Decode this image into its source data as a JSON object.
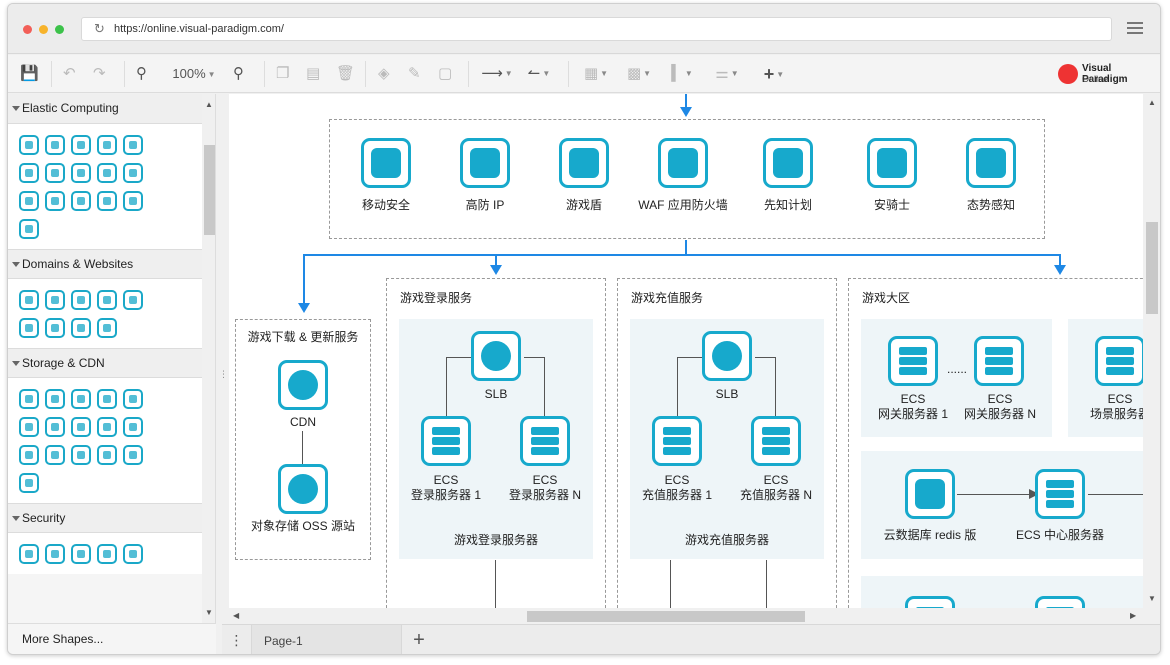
{
  "browser": {
    "url": "https://online.visual-paradigm.com/"
  },
  "toolbar": {
    "zoom": "100%",
    "logo_line1": "Visual Paradigm",
    "logo_line2": "Online"
  },
  "sidebar": {
    "categories": [
      {
        "name": "Elastic Computing"
      },
      {
        "name": "Domains & Websites"
      },
      {
        "name": "Storage & CDN"
      },
      {
        "name": "Security"
      }
    ],
    "more_shapes": "More Shapes..."
  },
  "pages": {
    "current": "Page-1"
  },
  "diagram": {
    "security": [
      "移动安全",
      "高防 IP",
      "游戏盾",
      "WAF 应用防火墙",
      "先知计划",
      "安骑士",
      "态势感知"
    ],
    "download": {
      "title": "游戏下载 & 更新服务",
      "cdn": "CDN",
      "oss": "对象存储 OSS 源站"
    },
    "login": {
      "title": "游戏登录服务",
      "slb": "SLB",
      "ecs1_a": "ECS",
      "ecs1_b": "登录服务器 1",
      "ecs2_a": "ECS",
      "ecs2_b": "登录服务器 N",
      "group": "游戏登录服务器"
    },
    "pay": {
      "title": "游戏充值服务",
      "slb": "SLB",
      "ecs1_a": "ECS",
      "ecs1_b": "充值服务器 1",
      "ecs2_a": "ECS",
      "ecs2_b": "充值服务器 N",
      "group": "游戏充值服务器"
    },
    "zone": {
      "title": "游戏大区",
      "gw1_a": "ECS",
      "gw1_b": "网关服务器 1",
      "gw2_a": "ECS",
      "gw2_b": "网关服务器 N",
      "scene_a": "ECS",
      "scene_b": "场景服务器",
      "redis": "云数据库 redis 版",
      "center": "ECS 中心服务器",
      "ellipsis": "......"
    }
  }
}
